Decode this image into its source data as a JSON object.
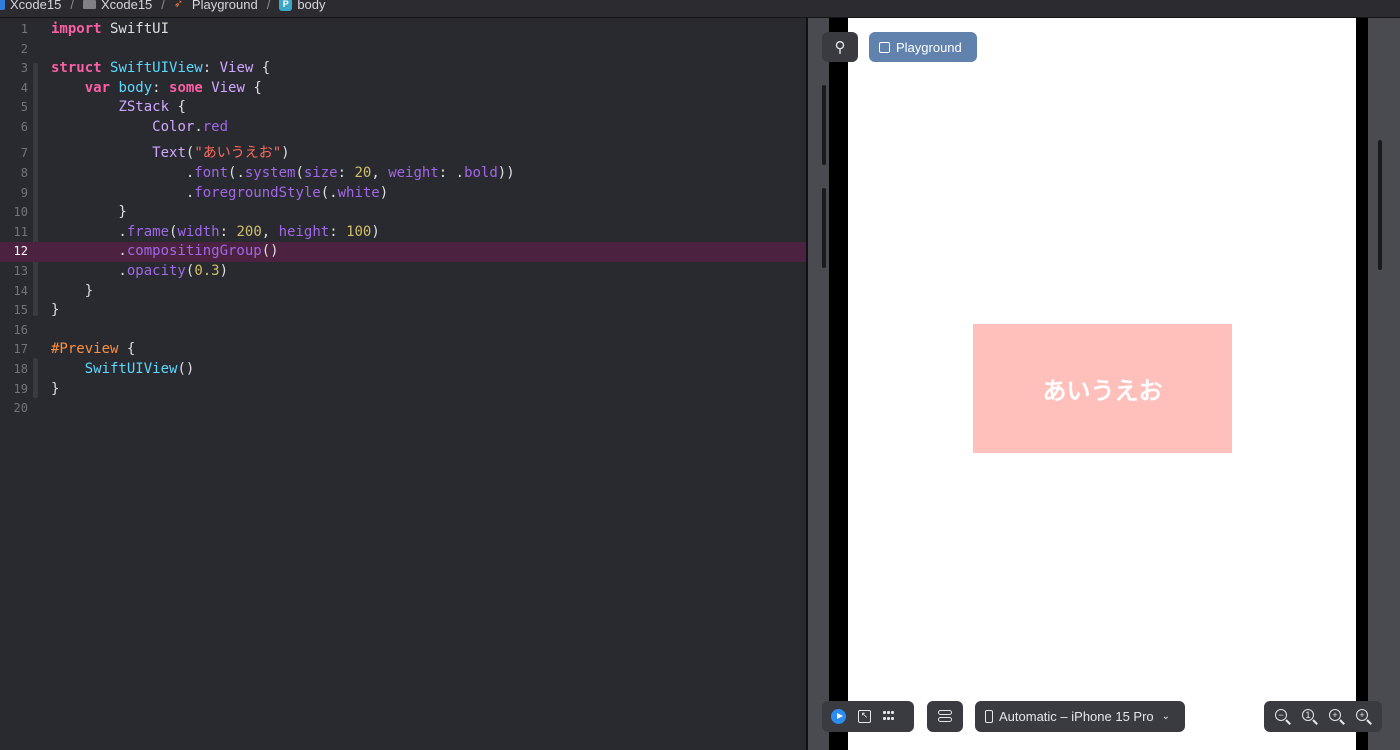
{
  "breadcrumb": {
    "items": [
      {
        "label": "Xcode15",
        "icon": "project-icon"
      },
      {
        "label": "Xcode15",
        "icon": "folder-icon"
      },
      {
        "label": "Playground",
        "icon": "swift-file-icon"
      },
      {
        "label": "body",
        "icon": "property-icon"
      }
    ],
    "separator": "/"
  },
  "editor": {
    "current_line": 12,
    "lines": [
      {
        "n": "1"
      },
      {
        "n": "2"
      },
      {
        "n": "3"
      },
      {
        "n": "4"
      },
      {
        "n": "5"
      },
      {
        "n": "6"
      },
      {
        "n": "7"
      },
      {
        "n": "8"
      },
      {
        "n": "9"
      },
      {
        "n": "10"
      },
      {
        "n": "11"
      },
      {
        "n": "12"
      },
      {
        "n": "13"
      },
      {
        "n": "14"
      },
      {
        "n": "15"
      },
      {
        "n": "16"
      },
      {
        "n": "17"
      },
      {
        "n": "18"
      },
      {
        "n": "19"
      },
      {
        "n": "20"
      }
    ],
    "code": {
      "l1": [
        "import",
        " SwiftUI"
      ],
      "l3": [
        "struct",
        " ",
        "SwiftUIView",
        ": ",
        "View",
        " {"
      ],
      "l4": [
        "    ",
        "var",
        " ",
        "body",
        ": ",
        "some",
        " ",
        "View",
        " {"
      ],
      "l5": [
        "        ",
        "ZStack",
        " {"
      ],
      "l6": [
        "            ",
        "Color",
        ".",
        "red"
      ],
      "l7": [
        "            ",
        "Text",
        "(",
        "\"あいうえお\"",
        ")"
      ],
      "l8": [
        "                .",
        "font",
        "(.",
        "system",
        "(",
        "size",
        ": ",
        "20",
        ", ",
        "weight",
        ": .",
        "bold",
        "))"
      ],
      "l9": [
        "                .",
        "foregroundStyle",
        "(.",
        "white",
        ")"
      ],
      "l10": [
        "        }"
      ],
      "l11": [
        "        .",
        "frame",
        "(",
        "width",
        ": ",
        "200",
        ", ",
        "height",
        ": ",
        "100",
        ")"
      ],
      "l12": [
        "        .",
        "compositingGroup",
        "()"
      ],
      "l13": [
        "        .",
        "opacity",
        "(",
        "0.3",
        ")"
      ],
      "l14": [
        "    }"
      ],
      "l15": [
        "}"
      ],
      "l17": [
        "#Preview",
        " {"
      ],
      "l18": [
        "    ",
        "SwiftUIView",
        "()"
      ],
      "l19": [
        "}"
      ]
    }
  },
  "preview": {
    "pin_icon": "pin-icon",
    "tab_label": "Playground",
    "rendered_text": "あいうえお",
    "box_color": "#ffc0bc",
    "box_opacity": 0.3
  },
  "toolbar": {
    "device_label": "Automatic – iPhone 15 Pro",
    "zoom_icons": [
      "zoom-out-icon",
      "zoom-to-100-icon",
      "zoom-in-icon",
      "zoom-to-fit-icon"
    ]
  },
  "colors": {
    "keyword": "#fc5fa3",
    "type": "#5dd8ff",
    "string": "#fc6a5d",
    "number": "#d0bf69",
    "current_line": "#4b2340",
    "tab_accent": "#6182ad"
  }
}
